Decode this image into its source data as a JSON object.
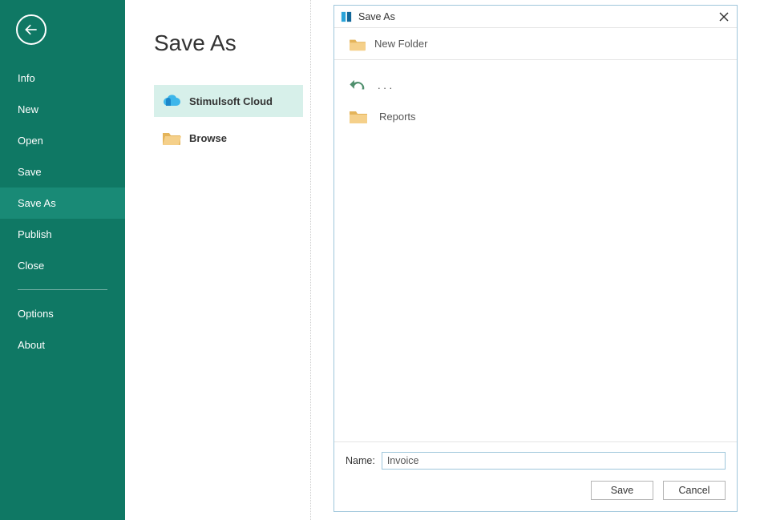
{
  "sidebar": {
    "items": [
      {
        "label": "Info"
      },
      {
        "label": "New"
      },
      {
        "label": "Open"
      },
      {
        "label": "Save"
      },
      {
        "label": "Save As"
      },
      {
        "label": "Publish"
      },
      {
        "label": "Close"
      }
    ],
    "secondary": [
      {
        "label": "Options"
      },
      {
        "label": "About"
      }
    ]
  },
  "page": {
    "title": "Save As",
    "locations": [
      {
        "label": "Stimulsoft Cloud"
      },
      {
        "label": "Browse"
      }
    ]
  },
  "dialog": {
    "title": "Save As",
    "newFolder": "New Folder",
    "up": ". . .",
    "items": [
      {
        "label": "Reports"
      }
    ],
    "nameLabel": "Name:",
    "nameValue": "Invoice",
    "saveLabel": "Save",
    "cancelLabel": "Cancel"
  }
}
